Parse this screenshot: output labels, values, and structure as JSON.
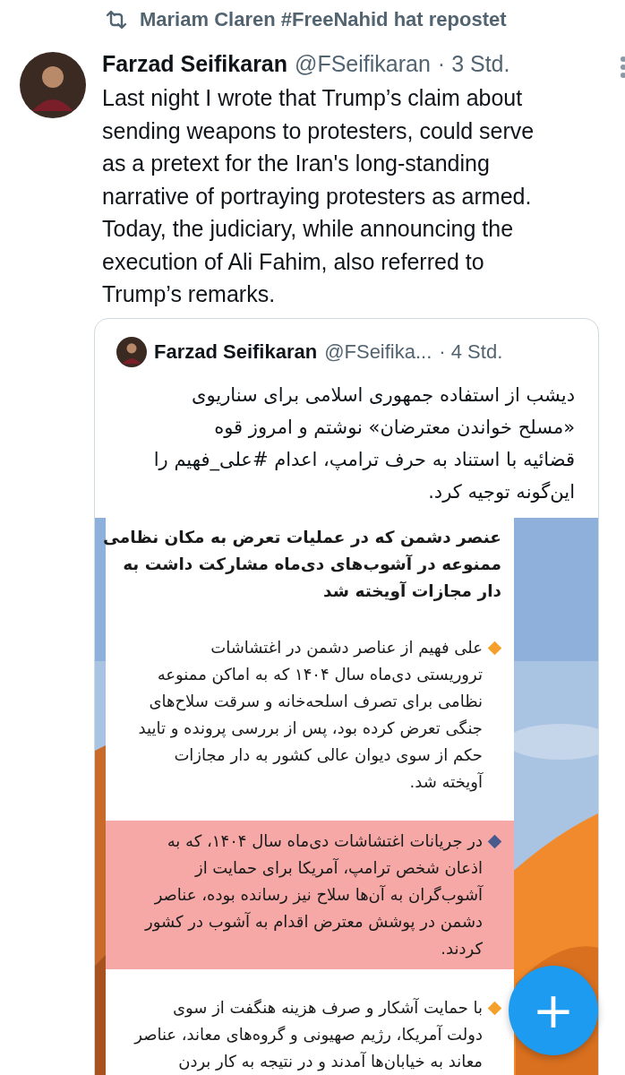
{
  "repost": {
    "label": "Mariam Claren #FreeNahid hat repostet"
  },
  "post": {
    "name": "Farzad Seifikaran",
    "handle": "@FSeifikaran",
    "time": "· 3 Std.",
    "text_lines": [
      "Last night I wrote that Trump’s claim about",
      "sending weapons to protesters, could serve",
      "as a pretext for the Iran's long-standing",
      "narrative of portraying protesters as armed.",
      "Today, the judiciary, while announcing the",
      "execution of Ali Fahim, also referred to",
      "Trump’s remarks."
    ]
  },
  "quote": {
    "name": "Farzad Seifikaran",
    "handle": "@FSeifika...",
    "time": "· 4 Std.",
    "text_lines": [
      "دیشب از استفاده جمهوری اسلامی برای سناریوی",
      "«مسلح خواندن معترضان» نوشتم و امروز قوه",
      "قضائیه با استناد به حرف ترامپ، اعدام #علی_فهیم را",
      "این‌گونه توجیه کرد."
    ],
    "image": {
      "title_lines": [
        "عنصر دشمن که در عملیات تعرض به مکان نظامی",
        "ممنوعه در آشوب‌های دی‌ماه مشارکت داشت به",
        "دار مجازات آویخته شد"
      ],
      "paragraphs": [
        {
          "color": "#f5a02a",
          "highlighted": false,
          "lines": [
            "علی فهیم از عناصر دشمن در اغتشاشات",
            "تروریستی دی‌ماه سال ۱۴۰۴ که به اماکن ممنوعه",
            "نظامی برای تصرف اسلحه‌خانه و سرقت سلاح‌های",
            "جنگی تعرض کرده بود، پس از بررسی پرونده و تایید",
            "حکم از سوی دیوان عالی کشور به دار مجازات",
            "آویخته شد."
          ]
        },
        {
          "color": "#4a5a8c",
          "highlighted": true,
          "lines": [
            "در جریانات اغتشاشات دی‌ماه سال ۱۴۰۴، که به",
            "اذعان شخص ترامپ، آمریکا برای حمایت از",
            "آشوب‌گران به آن‌ها سلاح نیز رسانده بوده، عناصر",
            "دشمن در پوشش معترض اقدام به آشوب در کشور",
            "کردند."
          ]
        },
        {
          "color": "#f5a02a",
          "highlighted": false,
          "lines": [
            "با حمایت آشکار و صرف هزینه هنگفت از سوی",
            "دولت آمریکا، رژیم صهیونی و گروه‌های معاند، عناصر",
            "معاند به خیابان‌ها آمدند و در نتیجه به کار بردن"
          ]
        }
      ]
    }
  },
  "fab": {
    "label": "+"
  }
}
